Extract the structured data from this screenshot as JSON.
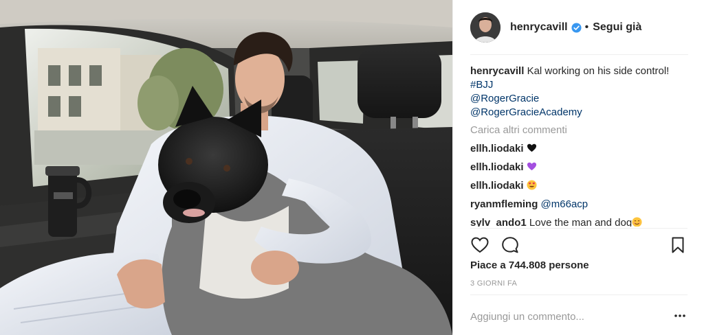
{
  "post": {
    "image_alt": "Uomo in kimono bianco seduto sul sedile posteriore di un'auto con un grande cane nero e bianco",
    "header": {
      "username": "henrycavill",
      "verified_icon": "verified-badge-icon",
      "separator": "•",
      "follow_label": "Segui già"
    },
    "caption": {
      "username": "henrycavill",
      "text": "Kal working on his side control!",
      "hashtags": [
        "#BJJ"
      ],
      "mentions": [
        "@RogerGracie",
        "@RogerGracieAcademy"
      ]
    },
    "load_more_label": "Carica altri commenti",
    "comments": [
      {
        "username": "ellh.liodaki",
        "text": "",
        "emoji": "black-heart-icon"
      },
      {
        "username": "ellh.liodaki",
        "text": "",
        "emoji": "purple-heart-icon"
      },
      {
        "username": "ellh.liodaki",
        "text": "",
        "emoji": "heart-eyes-icon"
      },
      {
        "username": "ryanmfleming",
        "text": "@m66acp",
        "emoji": ""
      },
      {
        "username": "sylv_ando1",
        "text": "Love the man and dog",
        "emoji": "smiling-face-icon"
      }
    ],
    "actions": {
      "like_icon": "heart-outline-icon",
      "comment_icon": "comment-bubble-icon",
      "save_icon": "bookmark-icon"
    },
    "likes_label": "Piace a 744.808 persone",
    "timestamp": "3 GIORNI FA",
    "add_comment_placeholder": "Aggiungi un commento...",
    "more_options_icon": "more-options-icon",
    "colors": {
      "text": "#262626",
      "link": "#003569",
      "muted": "#999999",
      "verified": "#3897f0",
      "divider": "#efefef"
    }
  }
}
